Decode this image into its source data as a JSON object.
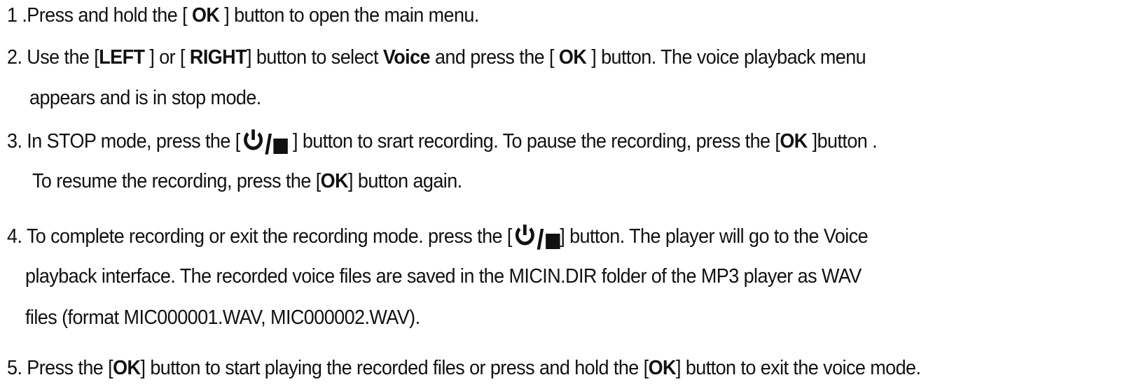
{
  "steps": [
    {
      "s1": {
        "a": "1 .Press and hold the [ ",
        "ok": "OK",
        "b": " ] button to open the main menu."
      }
    },
    {
      "s2": {
        "a": "2. Use the [",
        "left": "LEFT",
        "b": " ] or [ ",
        "right": "RIGHT",
        "c": "] button to select ",
        "voice": "Voice",
        "d": " and press the [ ",
        "ok": "OK",
        "e": " ] button.  The voice playback menu",
        "cont": "appears and is in stop mode."
      }
    },
    {
      "s3": {
        "a": "3. In STOP mode, press the [",
        "b": " ] button to srart recording.  To pause the recording, press the [",
        "ok1": "OK",
        "c": " ]button .",
        "cont_a": "To resume the recording, press the [",
        "ok2": "OK",
        "cont_b": "] button again."
      }
    },
    {
      "s4": {
        "a": "4. To complete recording or exit the recording mode. press the [",
        "b": "] button.  The player will go to the Voice",
        "cont1": "playback interface.  The recorded voice files are saved in the MICIN.DIR folder of the MP3 player as WAV",
        "cont2": "files (format MIC000001.WAV, MIC000002.WAV)."
      }
    },
    {
      "s5": {
        "a": "5. Press the [",
        "ok1": "OK",
        "b": "] button to start playing the recorded files or press and hold the [",
        "ok2": "OK",
        "c": "] button to exit the voice mode."
      }
    }
  ],
  "icons": {
    "power_stop": {
      "power": "power-icon",
      "slash": "/",
      "stop": "stop-icon"
    }
  }
}
